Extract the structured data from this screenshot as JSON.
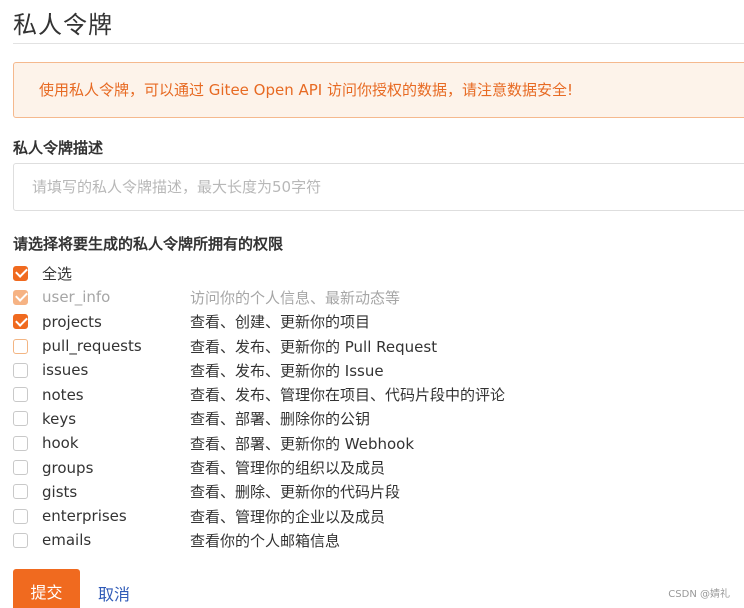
{
  "page": {
    "title": "私人令牌"
  },
  "alert": {
    "text": "使用私人令牌，可以通过 Gitee Open API 访问你授权的数据，请注意数据安全!"
  },
  "description": {
    "label": "私人令牌描述",
    "placeholder": "请填写的私人令牌描述，最大长度为50字符",
    "value": ""
  },
  "permissions": {
    "label": "请选择将要生成的私人令牌所拥有的权限",
    "select_all_label": "全选",
    "select_all_state": "checked",
    "items": [
      {
        "name": "user_info",
        "desc": "访问你的个人信息、最新动态等",
        "state": "checked-disabled"
      },
      {
        "name": "projects",
        "desc": "查看、创建、更新你的项目",
        "state": "checked"
      },
      {
        "name": "pull_requests",
        "desc": "查看、发布、更新你的 Pull Request",
        "state": "hover"
      },
      {
        "name": "issues",
        "desc": "查看、发布、更新你的 Issue",
        "state": "unchecked"
      },
      {
        "name": "notes",
        "desc": "查看、发布、管理你在项目、代码片段中的评论",
        "state": "unchecked"
      },
      {
        "name": "keys",
        "desc": "查看、部署、删除你的公钥",
        "state": "unchecked"
      },
      {
        "name": "hook",
        "desc": "查看、部署、更新你的 Webhook",
        "state": "unchecked"
      },
      {
        "name": "groups",
        "desc": "查看、管理你的组织以及成员",
        "state": "unchecked"
      },
      {
        "name": "gists",
        "desc": "查看、删除、更新你的代码片段",
        "state": "unchecked"
      },
      {
        "name": "enterprises",
        "desc": "查看、管理你的企业以及成员",
        "state": "unchecked"
      },
      {
        "name": "emails",
        "desc": "查看你的个人邮箱信息",
        "state": "unchecked"
      }
    ]
  },
  "actions": {
    "submit_label": "提交",
    "cancel_label": "取消"
  },
  "watermark": {
    "text": "CSDN @婧礼"
  },
  "colors": {
    "accent": "#f06a1f",
    "accent_light": "#f6b384",
    "alert_bg": "#fdf3ea",
    "alert_border": "#f5b98e",
    "alert_text": "#e76a23",
    "link": "#2f5ab7"
  }
}
